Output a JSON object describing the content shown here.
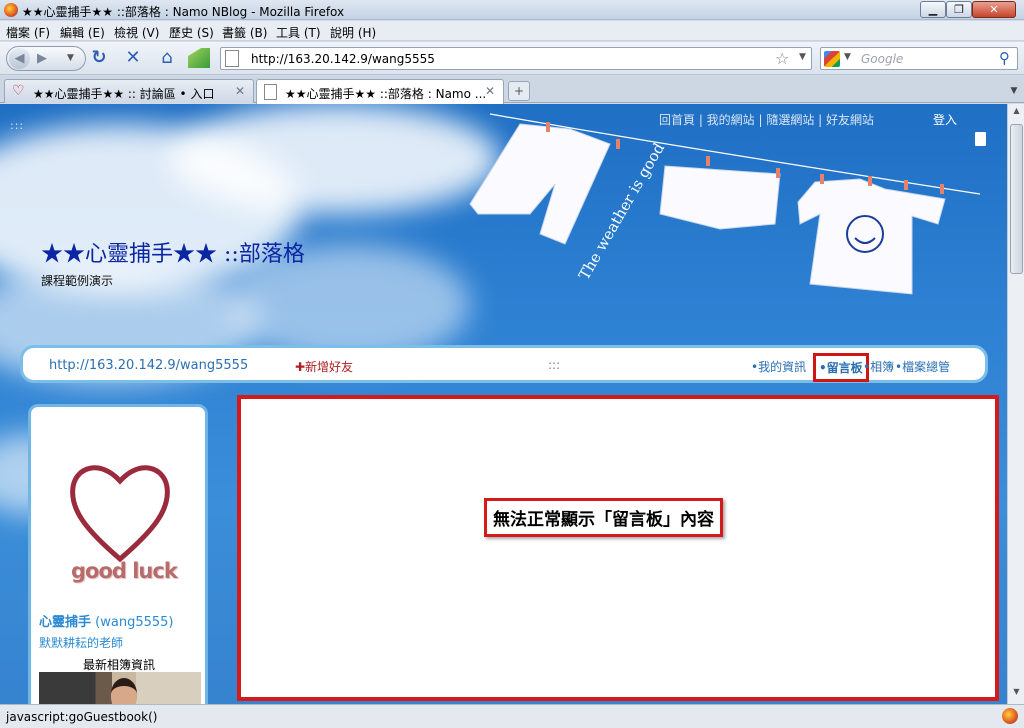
{
  "window": {
    "title": "★★心靈捕手★★ ::部落格 : Namo NBlog - Mozilla Firefox",
    "min_glyph": "▁",
    "max_glyph": "❐",
    "close_glyph": "✕"
  },
  "menu": [
    "檔案 (F)",
    "編輯 (E)",
    "檢視 (V)",
    "歷史 (S)",
    "書籤 (B)",
    "工具 (T)",
    "說明 (H)"
  ],
  "nav": {
    "url": "http://163.20.142.9/wang5555",
    "search_placeholder": "Google",
    "reload_glyph": "↻",
    "stop_glyph": "✕",
    "home_glyph": "⌂",
    "star_glyph": "☆",
    "search_glyph": "⚲"
  },
  "tabs": [
    {
      "label": "★★心靈捕手★★ :: 討論區 • 入口",
      "icon": "heart-icon",
      "active": false
    },
    {
      "label": "★★心靈捕手★★ ::部落格 : Namo ...",
      "icon": "page-icon",
      "active": true
    }
  ],
  "page": {
    "top_links": "回首頁 | 我的網站 | 隨選網站 | 好友網站",
    "login": "登入",
    "dots": ":::",
    "blog_title": "★★心靈捕手★★ ::部落格",
    "blog_subtitle": "課程範例演示",
    "banner_text": "The weather is good",
    "navstrip": {
      "url": "http://163.20.142.9/wang5555",
      "add_friend": "✚新增好友",
      "dots": ":::",
      "my_info": "•我的資訊",
      "guestbook": "•留言板",
      "album": "•相簿",
      "files": "•檔案總管"
    },
    "sidebar": {
      "goodluck": "good luck",
      "name": "心靈捕手",
      "user": "(wang5555)",
      "desc": "默默耕耘的老師",
      "album_title": "最新相簿資訊"
    },
    "error_message": "無法正常顯示「留言板」內容"
  },
  "status": {
    "text": "javascript:goGuestbook()"
  }
}
